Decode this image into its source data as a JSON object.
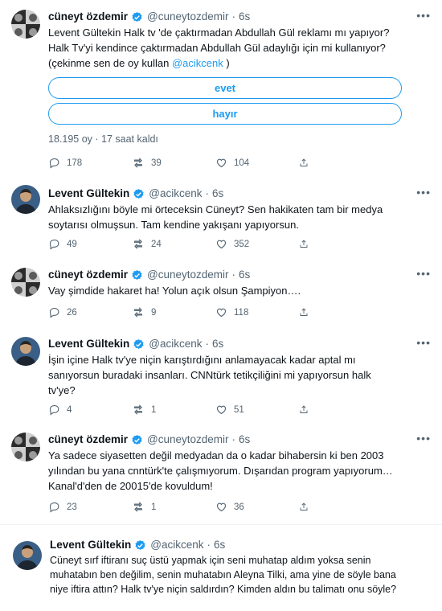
{
  "users": {
    "cuneyt": {
      "name": "cüneyt özdemir",
      "handle": "@cuneytozdemir"
    },
    "levent": {
      "name": "Levent Gültekin",
      "handle": "@acikcenk"
    }
  },
  "colors": {
    "accent": "#1d9bf0",
    "text": "#0f1419",
    "muted": "#536471",
    "verified": "#1d9bf0"
  },
  "icons": {
    "reply": "reply-icon",
    "retweet": "retweet-icon",
    "like": "like-icon",
    "share": "share-icon",
    "more": "more-icon",
    "verified": "verified-badge-icon"
  },
  "tweets": [
    {
      "time": "6s",
      "text": "Levent Gültekin Halk tv 'de çaktırmadan Abdullah Gül reklamı mı yapıyor? Halk Tv'yi kendince çaktırmadan Abdullah Gül adaylığı için mi kullanıyor? (çekinme sen de oy kullan",
      "mention": "@acikcenk",
      "text_after": " )",
      "poll": {
        "option_1": "evet",
        "option_2": "hayır",
        "meta": "18.195 oy · 17 saat kaldı"
      },
      "replies": "178",
      "retweets": "39",
      "likes": "104"
    },
    {
      "time": "6s",
      "text": "Ahlaksızlığını böyle mi örteceksin Cüneyt? Sen hakikaten tam bir medya soytarısı olmuşsun. Tam kendine yakışanı yapıyorsun.",
      "replies": "49",
      "retweets": "24",
      "likes": "352"
    },
    {
      "time": "6s",
      "text": "Vay şimdide hakaret ha! Yolun açık olsun Şampiyon….",
      "replies": "26",
      "retweets": "9",
      "likes": "118"
    },
    {
      "time": "6s",
      "text": "İşin içine Halk tv'ye niçin karıştırdığını anlamayacak kadar aptal mı sanıyorsun buradaki insanları. CNNtürk tetikçiliğini mi yapıyorsun halk tv'ye?",
      "replies": "4",
      "retweets": "1",
      "likes": "51"
    },
    {
      "time": "6s",
      "text": "Ya sadece siyasetten değil medyadan da o kadar bihabersin ki ben 2003 yılından bu yana cnntürk'te çalışmıyorum. Dışarıdan program yapıyorum… Kanal'd'den de 20015'de kovuldum!",
      "replies": "23",
      "retweets": "1",
      "likes": "36"
    },
    {
      "time": "6s",
      "text": "Cüneyt sırf iftiranı suç üstü yapmak için seni muhatap aldım yoksa senin muhatabın ben değilim, senin muhatabın Aleyna Tilki, ama yine de söyle bana niye iftira attın? Halk tv'ye niçin saldırdın? Kimden aldın bu talimatı onu söyle?"
    }
  ]
}
